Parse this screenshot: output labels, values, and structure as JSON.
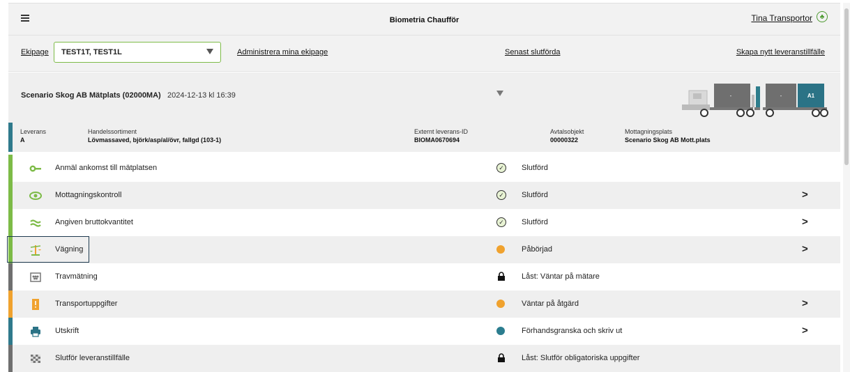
{
  "header": {
    "app_title": "Biometria Chaufför",
    "user_name": "Tina Transportor",
    "menu_icon": "hamburger-icon",
    "user_icon": "tree-icon"
  },
  "toolbar": {
    "ekipage_label": "Ekipage",
    "ekipage_value": "TEST1T, TEST1L",
    "admin_link": "Administrera mina ekipage",
    "recent_link": "Senast slutförda",
    "create_link": "Skapa nytt leveranstillfälle"
  },
  "scenario": {
    "title": "Scenario Skog AB Mätplats (02000MA)",
    "date": "2024-12-13 kl 16:39",
    "truck_labels": [
      "-",
      "-",
      "A1"
    ]
  },
  "delivery": {
    "leverans_label": "Leverans",
    "leverans_value": "A",
    "sortiment_label": "Handelssortiment",
    "sortiment_value": "Lövmassaved, björk/asp/al/övr, fallgd (103-1)",
    "ext_id_label": "Externt leverans-ID",
    "ext_id_value": "BIOMA0670694",
    "avtal_label": "Avtalsobjekt",
    "avtal_value": "00000322",
    "mott_label": "Mottagningsplats",
    "mott_value": "Scenario Skog AB Mott.plats"
  },
  "steps": [
    {
      "label": "Anmäl ankomst till mätplatsen",
      "status": "Slutförd",
      "icon": "key-icon",
      "status_icon": "check-icon",
      "has_chevron": false
    },
    {
      "label": "Mottagningskontroll",
      "status": "Slutförd",
      "icon": "eye-icon",
      "status_icon": "check-icon",
      "has_chevron": true
    },
    {
      "label": "Angiven bruttokvantitet",
      "status": "Slutförd",
      "icon": "approx-icon",
      "status_icon": "check-icon",
      "has_chevron": true
    },
    {
      "label": "Vägning",
      "status": "Påbörjad",
      "icon": "scale-icon",
      "status_icon": "orange-dot-icon",
      "has_chevron": true
    },
    {
      "label": "Travmätning",
      "status": "Låst: Väntar på mätare",
      "icon": "log-stack-icon",
      "status_icon": "lock-icon",
      "has_chevron": false
    },
    {
      "label": "Transportuppgifter",
      "status": "Väntar på åtgärd",
      "icon": "document-warning-icon",
      "status_icon": "orange-dot-icon",
      "has_chevron": true
    },
    {
      "label": "Utskrift",
      "status": "Förhandsgranska och skriv ut",
      "icon": "printer-icon",
      "status_icon": "blue-dot-icon",
      "has_chevron": true
    },
    {
      "label": "Slutför leveranstillfälle",
      "status": "Låst: Slutför obligatoriska uppgifter",
      "icon": "checkered-flag-icon",
      "status_icon": "lock-icon",
      "has_chevron": false
    }
  ],
  "chevron": ">",
  "colors": {
    "accent_green": "#7dbb47",
    "teal": "#2f7a8c",
    "orange": "#f0a22e",
    "grey": "#6f6f6f"
  }
}
